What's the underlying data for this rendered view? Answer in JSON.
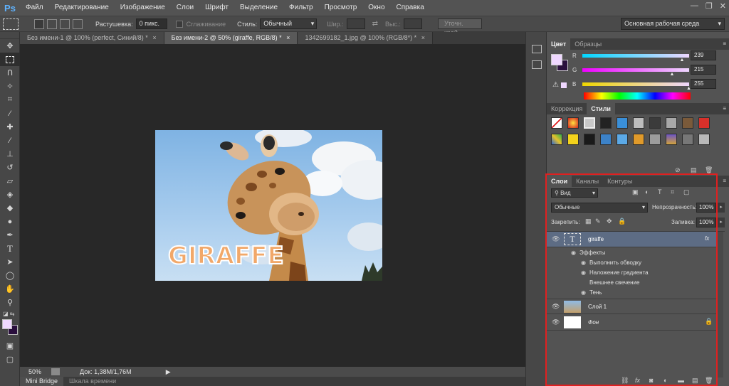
{
  "app": {
    "logo": "Ps"
  },
  "menu": [
    "Файл",
    "Редактирование",
    "Изображение",
    "Слои",
    "Шрифт",
    "Выделение",
    "Фильтр",
    "Просмотр",
    "Окно",
    "Справка"
  ],
  "window_controls": {
    "minimize": "—",
    "restore": "❐",
    "close": "✕"
  },
  "options": {
    "feather_label": "Растушевка:",
    "feather_value": "0 пикс.",
    "antialias_label": "Сглаживание",
    "style_label": "Стиль:",
    "style_value": "Обычный",
    "width_label": "Шир.:",
    "height_label": "Выс.:",
    "refine_button": "Уточн. край...",
    "workspace": "Основная рабочая среда"
  },
  "doc_tabs": [
    {
      "label": "Без имени-1 @ 100% (perfect, Синий/8) *",
      "close": "×",
      "active": false
    },
    {
      "label": "Без имени-2 @ 50% (giraffe, RGB/8) *",
      "close": "×",
      "active": true
    },
    {
      "label": "1342699182_1.jpg @ 100% (RGB/8*) *",
      "close": "×",
      "active": false
    }
  ],
  "canvas": {
    "image_text": "GIRAFFE"
  },
  "status": {
    "zoom": "50%",
    "doc_info": "Док: 1,38M/1,76M"
  },
  "bottom_tabs": [
    "Mini Bridge",
    "Шкала времени"
  ],
  "color_panel": {
    "tabs": [
      "Цвет",
      "Образцы"
    ],
    "channels": [
      {
        "label": "R",
        "value": "239",
        "fraction": 0.937
      },
      {
        "label": "G",
        "value": "215",
        "fraction": 0.843
      },
      {
        "label": "B",
        "value": "255",
        "fraction": 1.0
      }
    ],
    "fg_color": "#efd7ff",
    "bg_color": "#2a0f3d"
  },
  "styles_panel": {
    "tabs": [
      "Коррекция",
      "Стили"
    ]
  },
  "layers_panel": {
    "tabs": [
      "Слои",
      "Каналы",
      "Контуры"
    ],
    "kind_filter": "Вид",
    "blend_mode": "Обычные",
    "opacity_label": "Непрозрачность:",
    "opacity_value": "100%",
    "lock_label": "Закрепить:",
    "fill_label": "Заливка:",
    "fill_value": "100%",
    "layers": [
      {
        "name": "giraffe",
        "type": "text",
        "fx": "fx"
      },
      {
        "name": "Слой 1",
        "type": "image"
      },
      {
        "name": "Фон",
        "type": "background"
      }
    ],
    "effects_label": "Эффекты",
    "effects": [
      {
        "name": "Выполнить обводку",
        "visible": true
      },
      {
        "name": "Наложение градиента",
        "visible": true
      },
      {
        "name": "Внешнее свечение",
        "visible": false
      },
      {
        "name": "Тень",
        "visible": true
      }
    ]
  }
}
